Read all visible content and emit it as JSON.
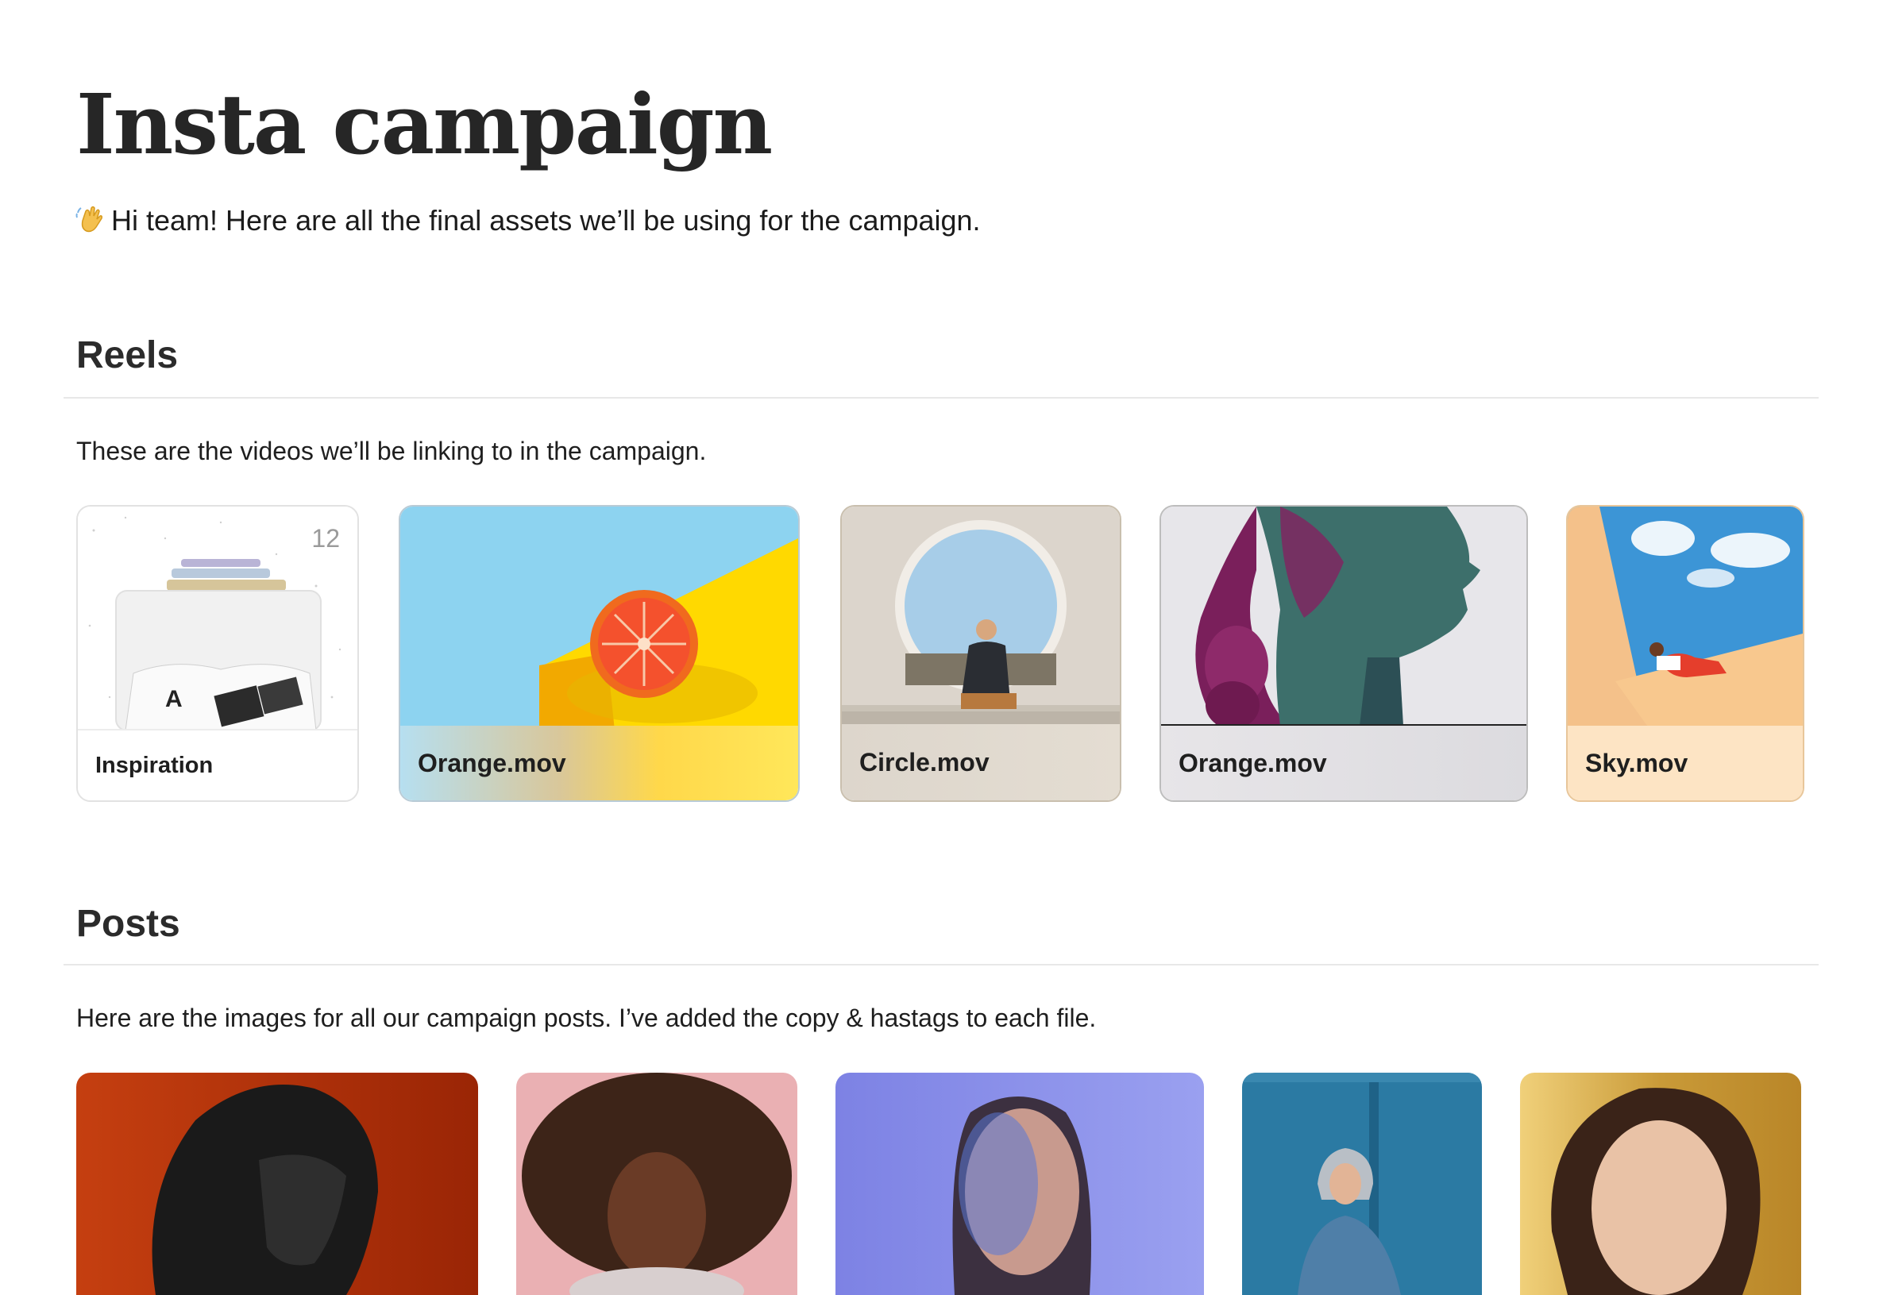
{
  "page": {
    "title": "Insta campaign",
    "intro_emoji": "waving-hand-icon",
    "intro_text": "Hi team! Here are all the final assets we’ll be using for the campaign."
  },
  "reels": {
    "heading": "Reels",
    "description": "These are the videos we’ll be linking to in the campaign.",
    "cards": [
      {
        "label": "Inspiration",
        "count": "12",
        "kind": "collection"
      },
      {
        "label": "Orange.mov",
        "kind": "video"
      },
      {
        "label": "Circle.mov",
        "kind": "video"
      },
      {
        "label": "Orange.mov",
        "kind": "video"
      },
      {
        "label": "Sky.mov",
        "kind": "video"
      }
    ]
  },
  "posts": {
    "heading": "Posts",
    "description": "Here are the images for all our campaign posts. I’ve added the copy & hastags to each file.",
    "items": [
      {
        "name": "post-image-red-portrait",
        "background": "#c2410c"
      },
      {
        "name": "post-image-pink-portrait",
        "background": "#e8a5a9"
      },
      {
        "name": "post-image-violet-portrait",
        "background": "#8f96e8"
      },
      {
        "name": "post-image-blue-wall",
        "background": "#2f7499"
      },
      {
        "name": "post-image-golden-portrait",
        "background": "#c99a38"
      }
    ]
  }
}
